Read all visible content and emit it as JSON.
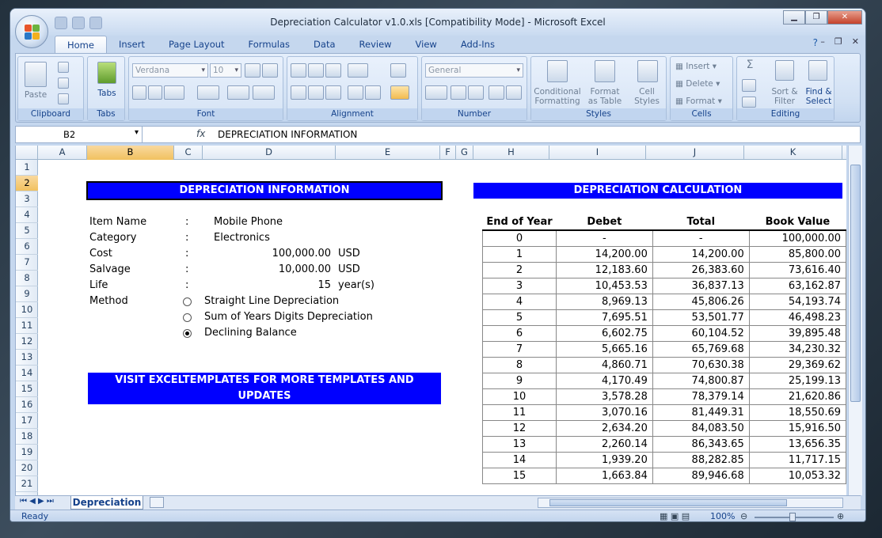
{
  "window": {
    "title": "Depreciation Calculator v1.0.xls  [Compatibility Mode]  -  Microsoft Excel"
  },
  "ribbon_tabs": [
    "Home",
    "Insert",
    "Page Layout",
    "Formulas",
    "Data",
    "Review",
    "View",
    "Add-Ins"
  ],
  "ribbon": {
    "clipboard": {
      "paste": "Paste",
      "label": "Clipboard"
    },
    "tabs": {
      "btn": "Tabs",
      "label": "Tabs"
    },
    "font": {
      "face": "Verdana",
      "size": "10",
      "label": "Font"
    },
    "alignment": {
      "label": "Alignment"
    },
    "number": {
      "format": "General",
      "label": "Number"
    },
    "styles": {
      "cond": "Conditional\nFormatting",
      "fmt_table": "Format\nas Table",
      "cell_styles": "Cell\nStyles",
      "label": "Styles"
    },
    "cells": {
      "insert": "Insert",
      "delete": "Delete",
      "format": "Format",
      "label": "Cells"
    },
    "editing": {
      "sort": "Sort &\nFilter",
      "find": "Find &\nSelect",
      "label": "Editing"
    }
  },
  "formula_bar": {
    "name_box": "B2",
    "fx": "fx",
    "value": "DEPRECIATION INFORMATION"
  },
  "columns": [
    "A",
    "B",
    "C",
    "D",
    "E",
    "F",
    "G",
    "H",
    "I",
    "J",
    "K"
  ],
  "rows": [
    "1",
    "2",
    "3",
    "4",
    "5",
    "6",
    "7",
    "8",
    "9",
    "10",
    "11",
    "12",
    "13",
    "14",
    "15",
    "16",
    "17",
    "18",
    "19",
    "20",
    "21"
  ],
  "info": {
    "header": "DEPRECIATION INFORMATION",
    "fields": [
      {
        "label": "Item Name",
        "sep": ":",
        "value": "Mobile Phone",
        "unit": ""
      },
      {
        "label": "Category",
        "sep": ":",
        "value": "Electronics",
        "unit": ""
      },
      {
        "label": "Cost",
        "sep": ":",
        "value": "100,000.00",
        "unit": "USD"
      },
      {
        "label": "Salvage",
        "sep": ":",
        "value": "10,000.00",
        "unit": "USD"
      },
      {
        "label": "Life",
        "sep": ":",
        "value": "15",
        "unit": "year(s)"
      }
    ],
    "method_label": "Method",
    "methods": [
      {
        "label": "Straight Line Depreciation",
        "selected": false
      },
      {
        "label": "Sum of Years Digits Depreciation",
        "selected": false
      },
      {
        "label": "Declining Balance",
        "selected": true
      }
    ],
    "visit": "VISIT EXCELTEMPLATES FOR MORE TEMPLATES AND UPDATES"
  },
  "calc": {
    "header": "DEPRECIATION CALCULATION",
    "columns": [
      "End of Year",
      "Debet",
      "Total",
      "Book Value"
    ],
    "rows": [
      [
        "0",
        "-",
        "-",
        "100,000.00"
      ],
      [
        "1",
        "14,200.00",
        "14,200.00",
        "85,800.00"
      ],
      [
        "2",
        "12,183.60",
        "26,383.60",
        "73,616.40"
      ],
      [
        "3",
        "10,453.53",
        "36,837.13",
        "63,162.87"
      ],
      [
        "4",
        "8,969.13",
        "45,806.26",
        "54,193.74"
      ],
      [
        "5",
        "7,695.51",
        "53,501.77",
        "46,498.23"
      ],
      [
        "6",
        "6,602.75",
        "60,104.52",
        "39,895.48"
      ],
      [
        "7",
        "5,665.16",
        "65,769.68",
        "34,230.32"
      ],
      [
        "8",
        "4,860.71",
        "70,630.38",
        "29,369.62"
      ],
      [
        "9",
        "4,170.49",
        "74,800.87",
        "25,199.13"
      ],
      [
        "10",
        "3,578.28",
        "78,379.14",
        "21,620.86"
      ],
      [
        "11",
        "3,070.16",
        "81,449.31",
        "18,550.69"
      ],
      [
        "12",
        "2,634.20",
        "84,083.50",
        "15,916.50"
      ],
      [
        "13",
        "2,260.14",
        "86,343.65",
        "13,656.35"
      ],
      [
        "14",
        "1,939.20",
        "88,282.85",
        "11,717.15"
      ],
      [
        "15",
        "1,663.84",
        "89,946.68",
        "10,053.32"
      ]
    ]
  },
  "sheet_tab": "Depreciation",
  "status": {
    "ready": "Ready",
    "zoom": "100%"
  }
}
